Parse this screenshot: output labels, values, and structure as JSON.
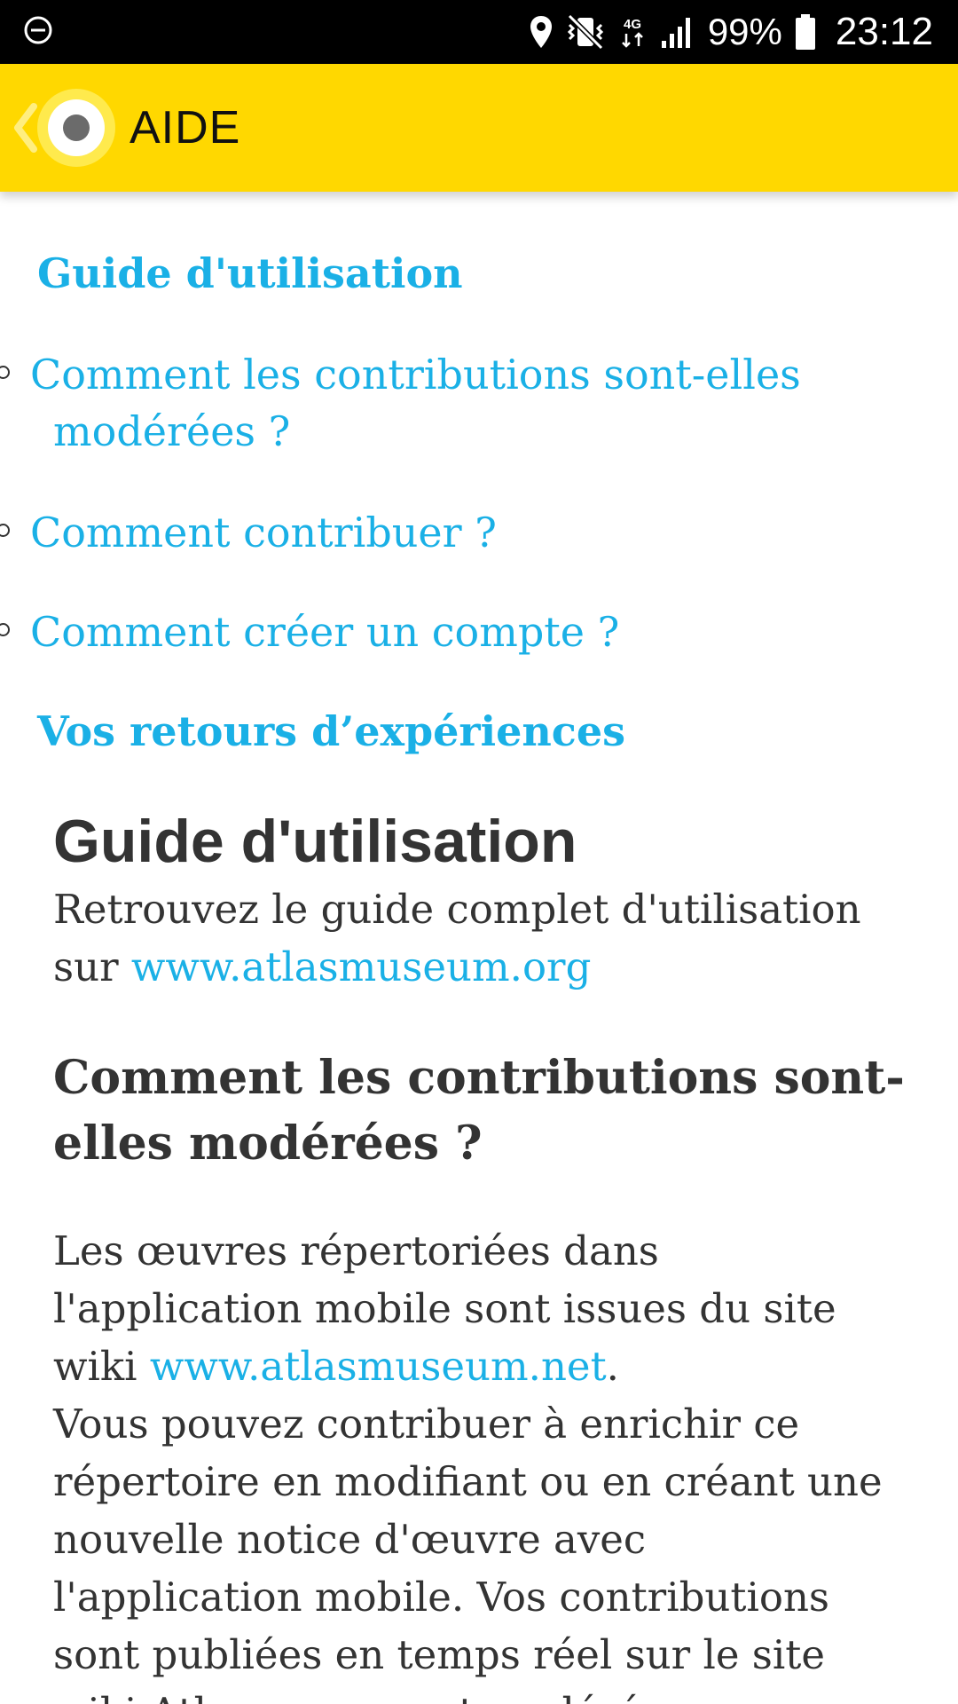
{
  "status_bar": {
    "battery_percent": "99%",
    "clock": "23:12",
    "network": "4G",
    "icons": [
      "do-not-disturb-icon",
      "location-icon",
      "vibrate-icon",
      "network-4g-icon",
      "signal-icon",
      "battery-icon"
    ]
  },
  "app_bar": {
    "title": "AIDE",
    "background": "#ffd800"
  },
  "toc": {
    "heading_guide": "Guide d'utilisation",
    "items": [
      {
        "label": "Comment les contributions sont-elles modérées ?"
      },
      {
        "label": "Comment contribuer ?"
      },
      {
        "label": "Comment créer un compte ?"
      }
    ],
    "heading_feedback": "Vos retours d’expériences"
  },
  "guide": {
    "title": "Guide d'utilisation",
    "text": "Retrouvez le guide complet d'utilisation sur ",
    "link": "www.atlasmuseum.org"
  },
  "moderation": {
    "title": "Comment les contributions sont-elles modérées ?",
    "para1_prefix": "Les œuvres répertoriées dans l'application mobile sont issues du site wiki ",
    "para1_link": "www.atlasmuseum.net",
    "para1_suffix": ".",
    "para2": "Vous pouvez contribuer à enrichir ce répertoire en modifiant ou en créant une nouvelle notice d'œuvre avec l'application mobile. Vos contributions sont publiées en temps réel sur le site wiki Atlasmuseum et modérées"
  },
  "colors": {
    "accent": "#1ab0e6",
    "text": "#333333",
    "app_bar": "#ffd800"
  }
}
